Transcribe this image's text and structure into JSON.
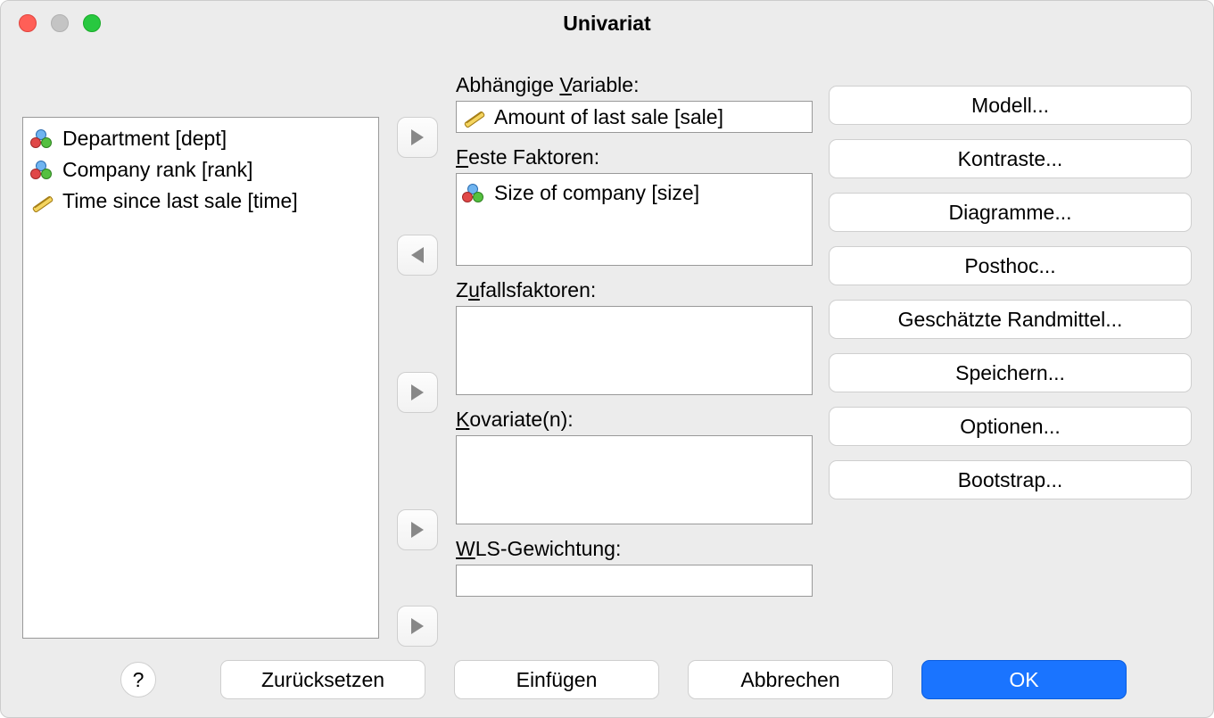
{
  "window": {
    "title": "Univariat"
  },
  "source_variables": [
    {
      "icon": "nominal",
      "label": "Department [dept]"
    },
    {
      "icon": "nominal",
      "label": "Company rank [rank]"
    },
    {
      "icon": "scale",
      "label": "Time since last sale [time]"
    }
  ],
  "sections": {
    "dependent": {
      "label_pre": "Abhängige ",
      "label_u": "V",
      "label_post": "ariable:",
      "item_icon": "scale",
      "item_label": "Amount of last sale [sale]"
    },
    "fixed": {
      "label_pre": "",
      "label_u": "F",
      "label_post": "este Faktoren:",
      "item_icon": "nominal",
      "item_label": "Size of company [size]"
    },
    "random": {
      "label_pre": "Z",
      "label_u": "u",
      "label_post": "fallsfaktoren:"
    },
    "covariate": {
      "label_pre": "",
      "label_u": "K",
      "label_post": "ovariate(n):"
    },
    "wls": {
      "label_pre": "",
      "label_u": "W",
      "label_post": "LS-Gewichtung:"
    }
  },
  "side_buttons": {
    "model": "Modell...",
    "contrasts": "Kontraste...",
    "plots": "Diagramme...",
    "posthoc": "Post hoc...",
    "emmeans": "Geschätzte Randmittel...",
    "save": "Speichern...",
    "options": "Optionen...",
    "bootstrap": "Bootstrap..."
  },
  "footer": {
    "help": "?",
    "reset": "Zurücksetzen",
    "paste": "Einfügen",
    "cancel": "Abbrechen",
    "ok": "OK"
  }
}
